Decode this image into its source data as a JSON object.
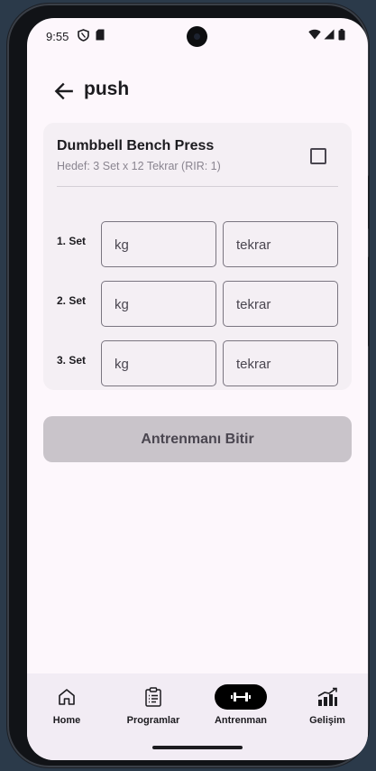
{
  "status_bar": {
    "time": "9:55"
  },
  "app_bar": {
    "title": "push"
  },
  "exercise": {
    "name": "Dumbbell Bench Press",
    "target": "Hedef: 3 Set x 12 Tekrar (RIR: 1)",
    "completed": false,
    "sets": [
      {
        "label": "1. Set",
        "kg_placeholder": "kg",
        "reps_placeholder": "tekrar"
      },
      {
        "label": "2. Set",
        "kg_placeholder": "kg",
        "reps_placeholder": "tekrar"
      },
      {
        "label": "3. Set",
        "kg_placeholder": "kg",
        "reps_placeholder": "tekrar"
      }
    ]
  },
  "finish_button": {
    "label": "Antrenmanı Bitir"
  },
  "bottom_nav": {
    "items": [
      {
        "label": "Home",
        "icon": "home-icon",
        "active": false
      },
      {
        "label": "Programlar",
        "icon": "clipboard-icon",
        "active": false
      },
      {
        "label": "Antrenman",
        "icon": "dumbbell-icon",
        "active": true
      },
      {
        "label": "Gelişim",
        "icon": "bar-chart-icon",
        "active": false
      }
    ]
  },
  "colors": {
    "screen_bg": "#fdf7fc",
    "card_bg": "#f4eff4",
    "disabled_button_bg": "#c9c4ca",
    "active_nav_pill": "#000000"
  }
}
